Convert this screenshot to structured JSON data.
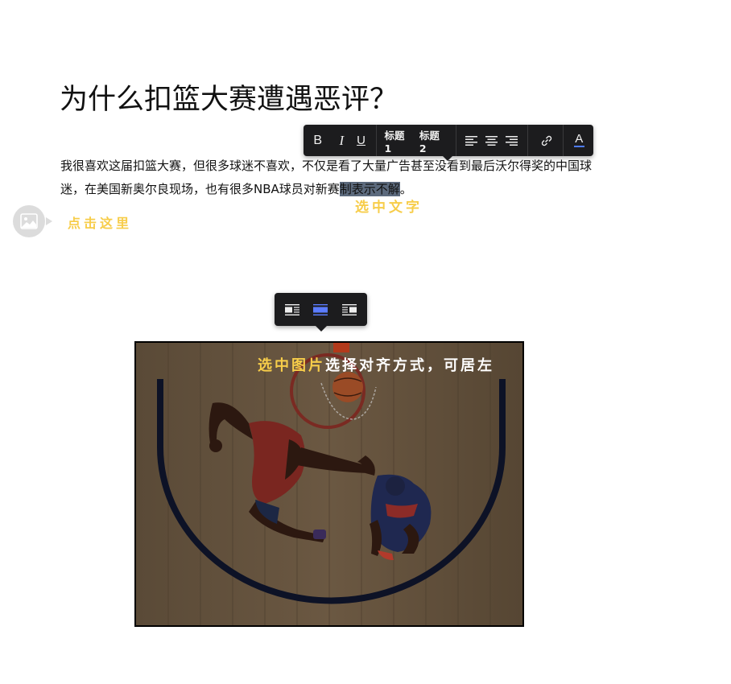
{
  "article": {
    "title": "为什么扣篮大赛遭遇恶评？",
    "paragraph_before": "我很喜欢这届扣篮大赛，但很多球迷不喜欢，不仅是看了大量广告甚至没看到最后沃尔得奖的中国球迷，在美国新奥尔良现场，也有很多NBA球员对新赛",
    "paragraph_selected": "制表示不解",
    "paragraph_after": "。"
  },
  "text_toolbar": {
    "bold": "B",
    "italic": "I",
    "underline": "U",
    "heading1": "标题 1",
    "heading2": "标题 2",
    "icons": [
      "align-left-icon",
      "align-center-icon",
      "align-right-icon",
      "link-icon",
      "text-color-icon"
    ],
    "text_color_letter": "A",
    "text_color_accent": "#4e7bff"
  },
  "image_toolbar": {
    "icons": [
      "float-left-icon",
      "align-center-block-icon",
      "float-right-icon"
    ],
    "active": "align-center-block-icon",
    "active_color": "#5b7cff"
  },
  "annotations": {
    "select_text": "选中文字",
    "click_here": "点击这里",
    "select_image": "选中图片",
    "select_image_rest": "选择对齐方式，可居左",
    "accent_color": "#f7cd4a"
  }
}
